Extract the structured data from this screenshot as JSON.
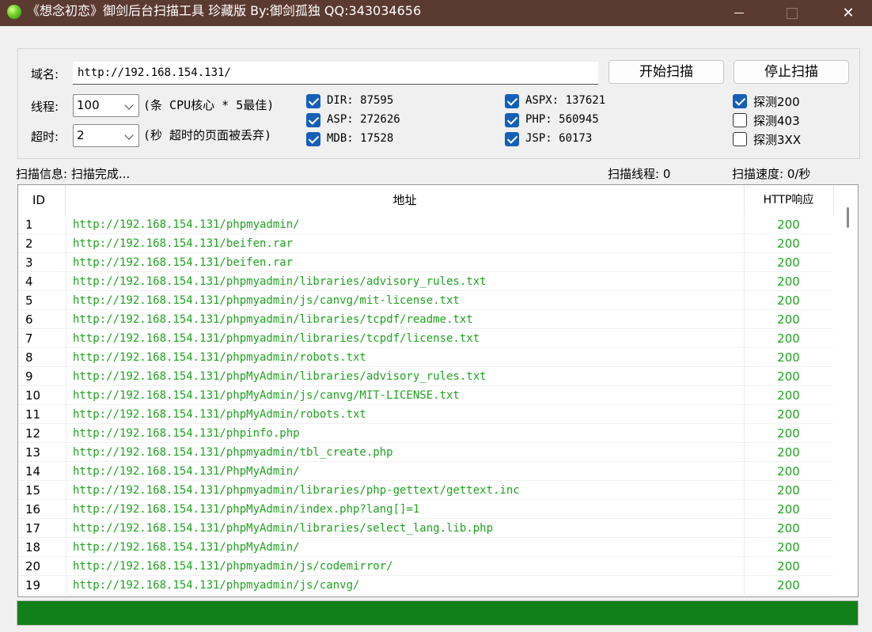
{
  "window": {
    "title": "《想念初恋》御剑后台扫描工具 珍藏版 By:御剑孤独 QQ:343034656",
    "minimize_glyph": "",
    "close_glyph": "✕"
  },
  "form": {
    "domain_label": "域名:",
    "domain_value": "http://192.168.154.131/",
    "start_button": "开始扫描",
    "stop_button": "停止扫描",
    "threads_label": "线程:",
    "threads_value": "100",
    "threads_hint": "(条 CPU核心 * 5最佳)",
    "timeout_label": "超时:",
    "timeout_value": "2",
    "timeout_hint": "(秒 超时的页面被丢弃)"
  },
  "dicts": [
    {
      "label": "DIR: 87595",
      "checked": true
    },
    {
      "label": "ASP: 272626",
      "checked": true
    },
    {
      "label": "MDB: 17528",
      "checked": true
    },
    {
      "label": "ASPX: 137621",
      "checked": true
    },
    {
      "label": "PHP: 560945",
      "checked": true
    },
    {
      "label": "JSP: 60173",
      "checked": true
    }
  ],
  "detect": [
    {
      "label": "探测200",
      "checked": true
    },
    {
      "label": "探测403",
      "checked": false
    },
    {
      "label": "探测3XX",
      "checked": false
    }
  ],
  "status": {
    "scan_info": "扫描信息: 扫描完成...",
    "scan_threads": "扫描线程: 0",
    "scan_speed": "扫描速度: 0/秒"
  },
  "table": {
    "headers": {
      "id": "ID",
      "url": "地址",
      "http": "HTTP响应"
    },
    "rows": [
      {
        "id": "1",
        "url": "http://192.168.154.131/phpmyadmin/",
        "code": "200"
      },
      {
        "id": "2",
        "url": "http://192.168.154.131/beifen.rar",
        "code": "200"
      },
      {
        "id": "3",
        "url": "http://192.168.154.131/beifen.rar",
        "code": "200"
      },
      {
        "id": "4",
        "url": "http://192.168.154.131/phpmyadmin/libraries/advisory_rules.txt",
        "code": "200"
      },
      {
        "id": "5",
        "url": "http://192.168.154.131/phpmyadmin/js/canvg/mit-license.txt",
        "code": "200"
      },
      {
        "id": "6",
        "url": "http://192.168.154.131/phpmyadmin/libraries/tcpdf/readme.txt",
        "code": "200"
      },
      {
        "id": "7",
        "url": "http://192.168.154.131/phpmyadmin/libraries/tcpdf/license.txt",
        "code": "200"
      },
      {
        "id": "8",
        "url": "http://192.168.154.131/phpmyadmin/robots.txt",
        "code": "200"
      },
      {
        "id": "9",
        "url": "http://192.168.154.131/phpMyAdmin/libraries/advisory_rules.txt",
        "code": "200"
      },
      {
        "id": "10",
        "url": "http://192.168.154.131/phpMyAdmin/js/canvg/MIT-LICENSE.txt",
        "code": "200"
      },
      {
        "id": "11",
        "url": "http://192.168.154.131/phpMyAdmin/robots.txt",
        "code": "200"
      },
      {
        "id": "12",
        "url": "http://192.168.154.131/phpinfo.php",
        "code": "200"
      },
      {
        "id": "13",
        "url": "http://192.168.154.131/phpmyadmin/tbl_create.php",
        "code": "200"
      },
      {
        "id": "14",
        "url": "http://192.168.154.131/PhpMyAdmin/",
        "code": "200"
      },
      {
        "id": "15",
        "url": "http://192.168.154.131/phpmyadmin/libraries/php-gettext/gettext.inc",
        "code": "200"
      },
      {
        "id": "16",
        "url": "http://192.168.154.131/phpMyAdmin/index.php?lang[]=1",
        "code": "200"
      },
      {
        "id": "17",
        "url": "http://192.168.154.131/phpMyAdmin/libraries/select_lang.lib.php",
        "code": "200"
      },
      {
        "id": "18",
        "url": "http://192.168.154.131/phpMyAdmin/",
        "code": "200"
      },
      {
        "id": "20",
        "url": "http://192.168.154.131/phpmyadmin/js/codemirror/",
        "code": "200"
      },
      {
        "id": "19",
        "url": "http://192.168.154.131/phpmyadmin/js/canvg/",
        "code": "200"
      }
    ]
  },
  "progress": {
    "fraction": 1.0,
    "color": "#118018"
  },
  "colors": {
    "titlebar": "#5b3a31",
    "url_text": "#1fa31f",
    "checkbox": "#1460b8"
  }
}
